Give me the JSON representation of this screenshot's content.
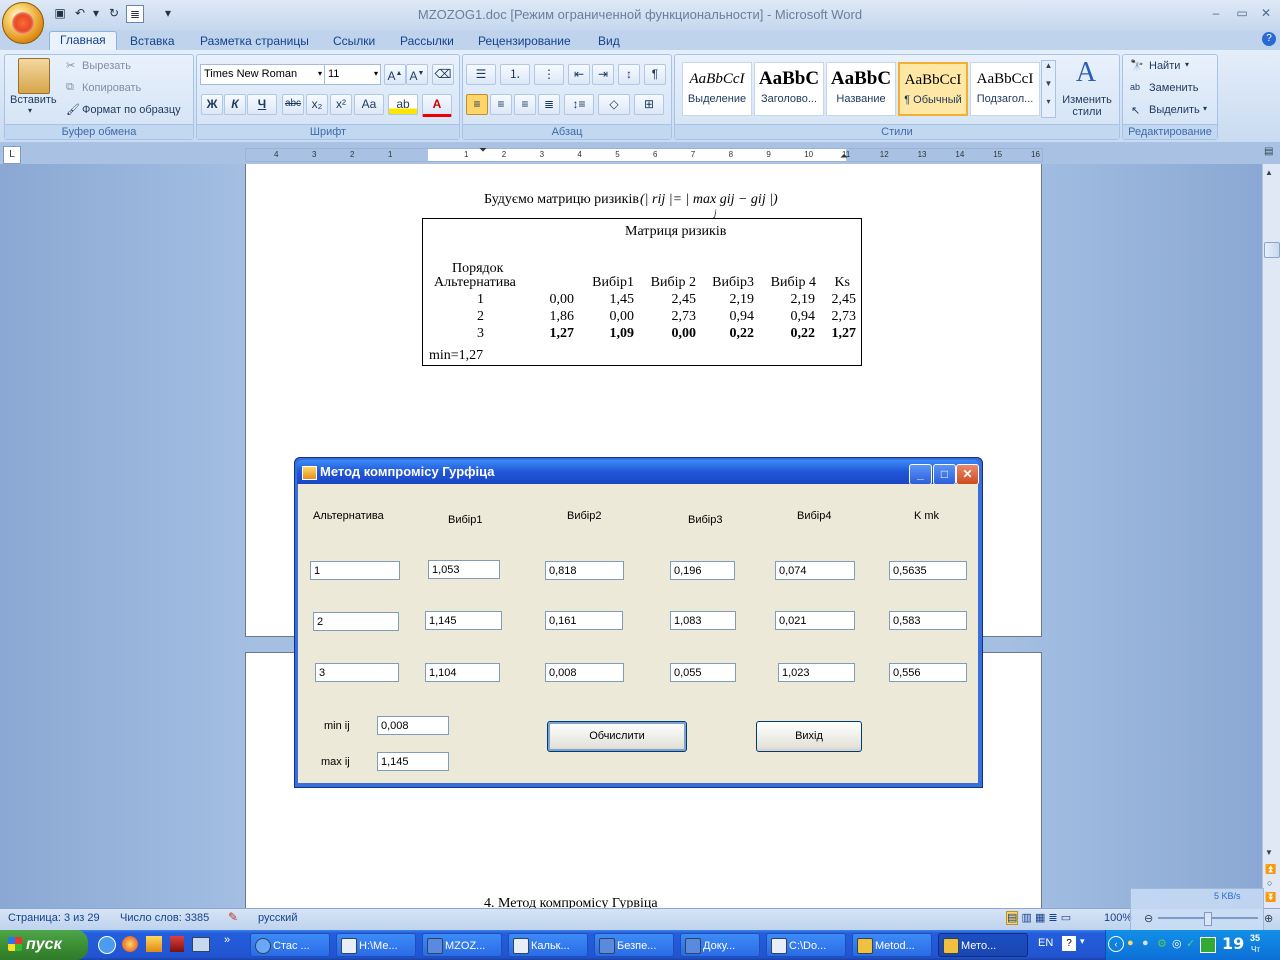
{
  "window": {
    "title": "MZOZOG1.doc [Режим ограниченной функциональности] - Microsoft Word"
  },
  "ribbon": {
    "tabs": [
      "Главная",
      "Вставка",
      "Разметка страницы",
      "Ссылки",
      "Рассылки",
      "Рецензирование",
      "Вид"
    ],
    "clipboard": {
      "paste_label": "Вставить",
      "cut_label": "Вырезать",
      "copy_label": "Копировать",
      "format_painter_label": "Формат по образцу",
      "group_label": "Буфер обмена"
    },
    "font": {
      "font_name": "Times New Roman",
      "font_size": "11",
      "group_label": "Шрифт",
      "bold": "Ж",
      "italic": "К",
      "underline": "Ч",
      "strike": "abc",
      "subscript": "x₂",
      "superscript": "x²",
      "case": "Aa"
    },
    "paragraph": {
      "group_label": "Абзац"
    },
    "styles": {
      "items": [
        {
          "sample": "AaBbCcI",
          "name": "Выделение"
        },
        {
          "sample": "AaBbC",
          "name": "Заголово..."
        },
        {
          "sample": "AaBbC",
          "name": "Название"
        },
        {
          "sample": "AaBbCcI",
          "name": "¶ Обычный"
        },
        {
          "sample": "AaBbCcI",
          "name": "Подзагол..."
        }
      ],
      "change_styles_label": "Изменить стили",
      "group_label": "Стили"
    },
    "editing": {
      "find_label": "Найти",
      "replace_label": "Заменить",
      "select_label": "Выделить",
      "group_label": "Редактирование"
    }
  },
  "ruler": {
    "numbers": [
      "4",
      "3",
      "2",
      "1",
      "1",
      "2",
      "3",
      "4",
      "5",
      "6",
      "7",
      "8",
      "9",
      "10",
      "11",
      "12",
      "13",
      "14",
      "15",
      "16"
    ]
  },
  "document": {
    "heading": "Будуємо матрицю ризиків",
    "formula": "(| rij |= | max gij − gij |)",
    "formula_sub": "j",
    "table": {
      "title": "Матриця ризиків",
      "order_label": "Порядок",
      "alt_label": "Альтернатива",
      "headers": [
        "Вибір1",
        "Вибір 2",
        "Вибір3",
        "Вибір 4",
        "Ks"
      ],
      "rows": [
        {
          "alt": "1",
          "values": [
            "0,00",
            "1,45",
            "2,45",
            "2,19",
            "2,19",
            "2,45"
          ]
        },
        {
          "alt": "2",
          "values": [
            "1,86",
            "0,00",
            "2,73",
            "0,94",
            "0,94",
            "2,73"
          ]
        },
        {
          "alt": "3",
          "values": [
            "1,27",
            "1,09",
            "0,00",
            "0,22",
            "0,22",
            "1,27"
          ]
        }
      ],
      "min_text": "min=1,27"
    },
    "section_heading": "4. Метод компромісу Гурвіца"
  },
  "dialog": {
    "title": "Метод компромісу Гурфіца",
    "headers": {
      "alt": "Альтернатива",
      "v1": "Вибір1",
      "v2": "Вибір2",
      "v3": "Вибір3",
      "v4": "Вибір4",
      "k": "K mk"
    },
    "rows": [
      {
        "alt": "1",
        "v1": "1,053",
        "v2": "0,818",
        "v3": "0,196",
        "v4": "0,074",
        "k": "0,5635"
      },
      {
        "alt": "2",
        "v1": "1,145",
        "v2": "0,161",
        "v3": "1,083",
        "v4": "0,021",
        "k": "0,583"
      },
      {
        "alt": "3",
        "v1": "1,104",
        "v2": "0,008",
        "v3": "0,055",
        "v4": "1,023",
        "k": "0,556"
      }
    ],
    "min_label": "min ij",
    "min_value": "0,008",
    "max_label": "max ij",
    "max_value": "1,145",
    "calc_button": "Обчислити",
    "exit_button": "Вихід"
  },
  "statusbar": {
    "page": "Страница: 3 из 29",
    "words": "Число слов: 3385",
    "language": "русский",
    "zoom": "100%",
    "net_speed": "5 KB/s"
  },
  "taskbar": {
    "start_label": "пуск",
    "tasks": [
      "Стас ...",
      "H:\\Ме...",
      "MZOZ...",
      "Кальк...",
      "Безпе...",
      "Доку...",
      "C:\\Do...",
      "Metod...",
      "Мето..."
    ],
    "lang": "EN",
    "clock_hour": "19",
    "clock_minute": "35",
    "clock_day": "Чт"
  },
  "colors": {
    "ribbon_text": "#15428b",
    "xp_title": "#2056d8",
    "dialog_body": "#ece9d8"
  }
}
